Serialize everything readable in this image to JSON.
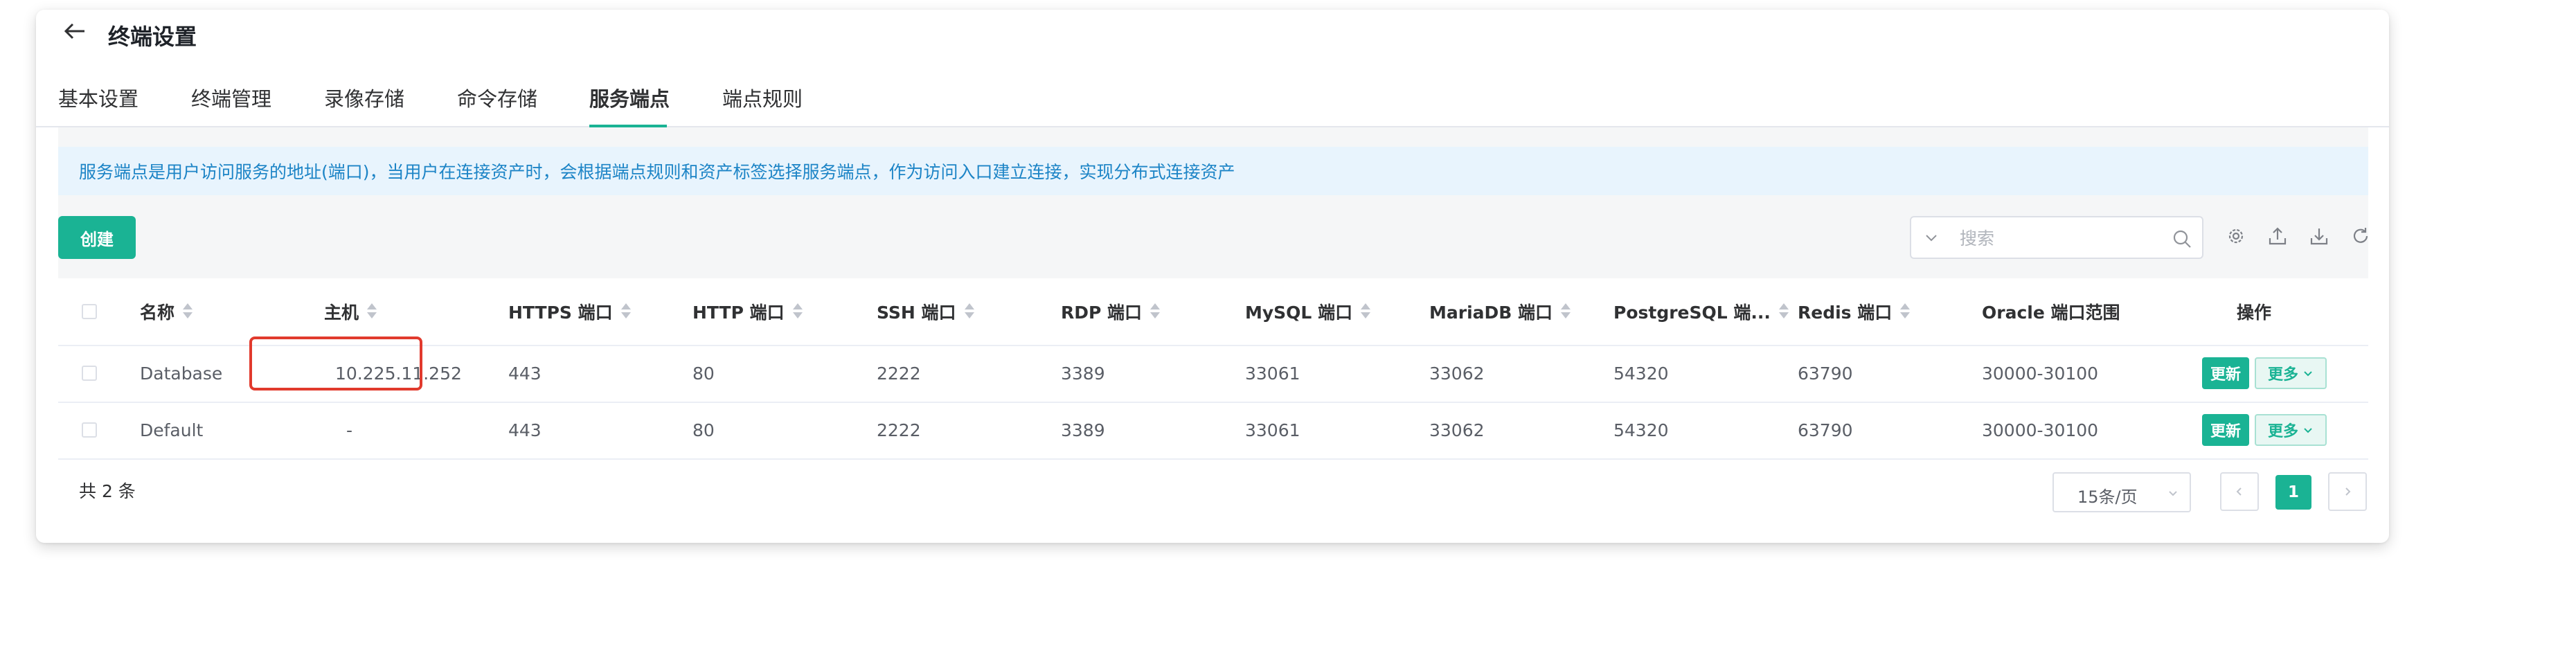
{
  "header": {
    "title": "终端设置"
  },
  "tabs": [
    {
      "label": "基本设置"
    },
    {
      "label": "终端管理"
    },
    {
      "label": "录像存储"
    },
    {
      "label": "命令存储"
    },
    {
      "label": "服务端点",
      "active": true
    },
    {
      "label": "端点规则"
    }
  ],
  "alert": {
    "text": "服务端点是用户访问服务的地址(端口)，当用户在连接资产时，会根据端点规则和资产标签选择服务端点，作为访问入口建立连接，实现分布式连接资产"
  },
  "toolbar": {
    "create_label": "创建",
    "search_placeholder": "搜索",
    "icons": [
      "settings-icon",
      "upload-icon",
      "download-icon",
      "refresh-icon"
    ]
  },
  "table": {
    "columns": {
      "name": "名称",
      "host": "主机",
      "https": "HTTPS 端口",
      "http": "HTTP 端口",
      "ssh": "SSH 端口",
      "rdp": "RDP 端口",
      "mysql": "MySQL 端口",
      "mariadb": "MariaDB 端口",
      "postgresql": "PostgreSQL 端...",
      "redis": "Redis 端口",
      "oracle": "Oracle 端口范围",
      "actions": "操作"
    },
    "rows": [
      {
        "name": "Database",
        "host": "10.225.11.252",
        "https": "443",
        "http": "80",
        "ssh": "2222",
        "rdp": "3389",
        "mysql": "33061",
        "mariadb": "33062",
        "postgresql": "54320",
        "redis": "63790",
        "oracle": "30000-30100",
        "update": "更新",
        "more": "更多"
      },
      {
        "name": "Default",
        "host": "-",
        "https": "443",
        "http": "80",
        "ssh": "2222",
        "rdp": "3389",
        "mysql": "33061",
        "mariadb": "33062",
        "postgresql": "54320",
        "redis": "63790",
        "oracle": "30000-30100",
        "update": "更新",
        "more": "更多"
      }
    ]
  },
  "pagination": {
    "total": "共 2 条",
    "page_size": "15条/页",
    "current_page": "1"
  },
  "colors": {
    "accent": "#1ab394",
    "alert_bg": "#e8f4fd",
    "alert_text": "#1c84c6",
    "highlight_border": "#e13a2d"
  }
}
